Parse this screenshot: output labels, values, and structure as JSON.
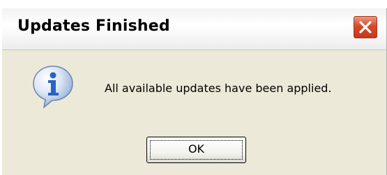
{
  "window": {
    "title": "Updates Finished",
    "close_icon": "close-icon"
  },
  "content": {
    "icon": "info-icon",
    "message": "All available updates have been applied."
  },
  "buttons": {
    "ok_label": "OK"
  },
  "colors": {
    "dialog_background": "#ece9d8",
    "close_button": "#d6492a",
    "info_icon": "#2a63c8"
  }
}
